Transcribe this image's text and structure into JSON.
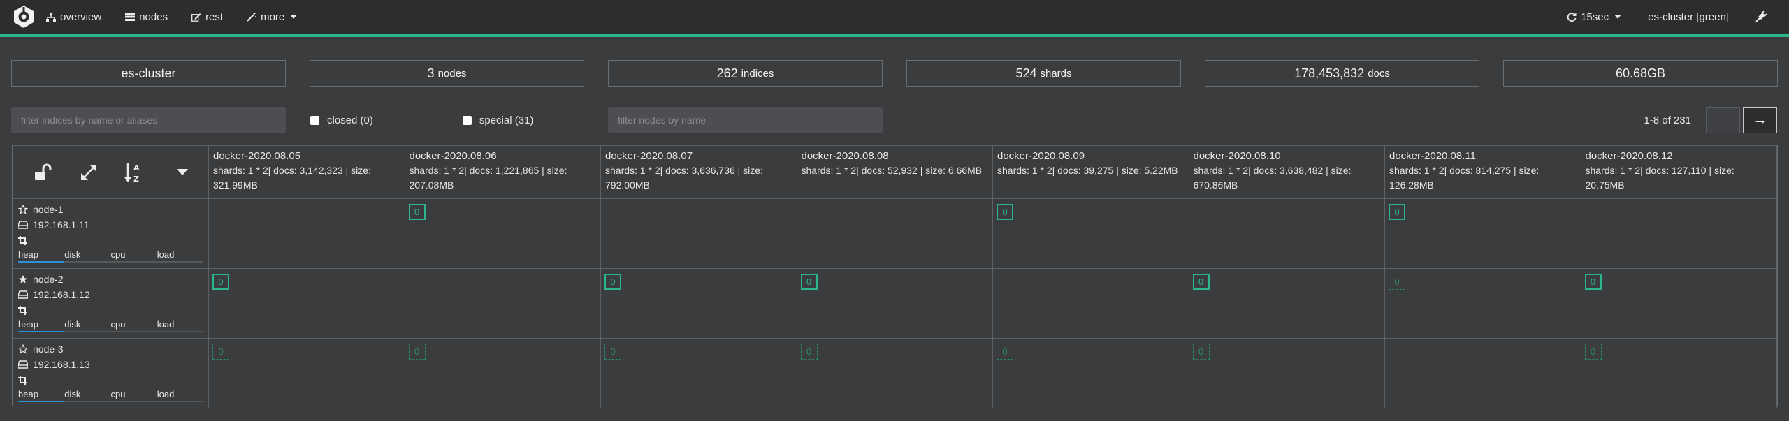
{
  "nav": {
    "items": [
      {
        "label": "overview",
        "icon": "sitemap-icon"
      },
      {
        "label": "nodes",
        "icon": "server-icon"
      },
      {
        "label": "rest",
        "icon": "edit-icon"
      },
      {
        "label": "more",
        "icon": "magic-icon"
      }
    ],
    "refresh": "15sec",
    "cluster": "es-cluster [green]",
    "accent": "#2bb58c"
  },
  "stats": {
    "cluster_name": "es-cluster",
    "nodes_value": "3",
    "nodes_unit": "nodes",
    "indices_value": "262",
    "indices_unit": "indices",
    "shards_value": "524",
    "shards_unit": "shards",
    "docs_value": "178,453,832",
    "docs_unit": "docs",
    "size": "60.68GB"
  },
  "filters": {
    "indices_placeholder": "filter indices by name or aliases",
    "closed_label": "closed (0)",
    "special_label": "special (31)",
    "nodes_placeholder": "filter nodes by name",
    "page_info": "1-8 of 231",
    "next_arrow": "→"
  },
  "indices": [
    {
      "name": "docker-2020.08.05",
      "info": "shards: 1 * 2| docs: 3,142,323 | size: 321.99MB"
    },
    {
      "name": "docker-2020.08.06",
      "info": "shards: 1 * 2| docs: 1,221,865 | size: 207.08MB"
    },
    {
      "name": "docker-2020.08.07",
      "info": "shards: 1 * 2| docs: 3,636,736 | size: 792.00MB"
    },
    {
      "name": "docker-2020.08.08",
      "info": "shards: 1 * 2| docs: 52,932 | size: 6.66MB"
    },
    {
      "name": "docker-2020.08.09",
      "info": "shards: 1 * 2| docs: 39,275 | size: 5.22MB"
    },
    {
      "name": "docker-2020.08.10",
      "info": "shards: 1 * 2| docs: 3,638,482 | size: 670.86MB"
    },
    {
      "name": "docker-2020.08.11",
      "info": "shards: 1 * 2| docs: 814,275 | size: 126.28MB"
    },
    {
      "name": "docker-2020.08.12",
      "info": "shards: 1 * 2| docs: 127,110 | size: 20.75MB"
    }
  ],
  "node_tabs": [
    "heap",
    "disk",
    "cpu",
    "load"
  ],
  "nodes": [
    {
      "name": "node-1",
      "ip": "192.168.1.11",
      "master": false,
      "shards": [
        "",
        "primary",
        "",
        "",
        "primary",
        "",
        "primary",
        ""
      ]
    },
    {
      "name": "node-2",
      "ip": "192.168.1.12",
      "master": true,
      "shards": [
        "primary",
        "",
        "primary",
        "primary",
        "",
        "primary",
        "replica",
        "primary"
      ]
    },
    {
      "name": "node-3",
      "ip": "192.168.1.13",
      "master": false,
      "shards": [
        "replica",
        "replica",
        "replica",
        "replica",
        "replica",
        "replica",
        "",
        "replica"
      ]
    }
  ],
  "shard_number": "0"
}
